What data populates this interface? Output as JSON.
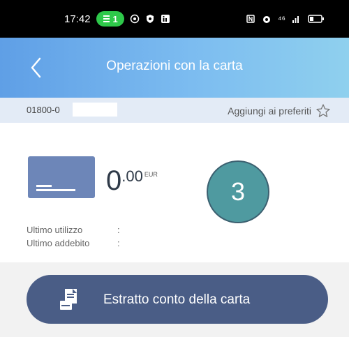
{
  "status_bar": {
    "time": "17:42",
    "notification_count": "1",
    "right_text": "⁴⁶"
  },
  "header": {
    "title": "Operazioni con la carta"
  },
  "card": {
    "number_visible": "01800-0",
    "favorites_label": "Aggiungi ai preferiti"
  },
  "balance": {
    "integer": "0",
    "decimal": ".00",
    "currency": "EUR"
  },
  "step_badge": "3",
  "info": {
    "last_use_label": "Ultimo utilizzo",
    "last_use_value": ":",
    "last_charge_label": "Ultimo addebito",
    "last_charge_value": ":"
  },
  "action": {
    "label": "Estratto conto della carta"
  },
  "colors": {
    "header_start": "#5f9fe6",
    "header_end": "#8fd0ee",
    "button_bg": "#4a5d86",
    "card_icon": "#6d86b8",
    "badge": "#4f9aa0"
  }
}
